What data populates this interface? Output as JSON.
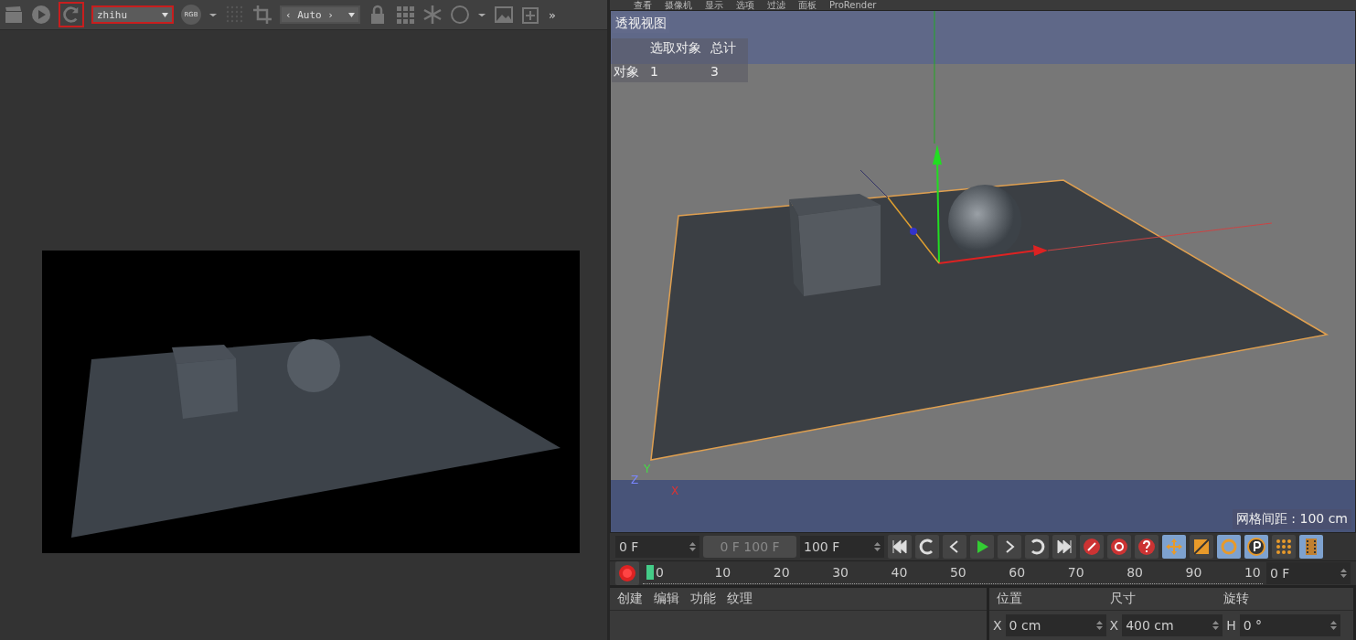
{
  "render_toolbar": {
    "preset": "zhihu",
    "channel_badge": "RGB",
    "zoom_mode": "‹ Auto ›",
    "overflow": "»"
  },
  "viewport_menu": [
    "查看",
    "摄像机",
    "显示",
    "选项",
    "过滤",
    "面板",
    "ProRender"
  ],
  "viewport": {
    "title": "透视视图",
    "stats": {
      "header": [
        "选取对象",
        "总计"
      ],
      "row_label": "对象",
      "selected": "1",
      "total": "3"
    },
    "grid_spacing": "网格间距 : 100 cm",
    "axis_labels": [
      "Z",
      "Y",
      "X"
    ]
  },
  "timeline": {
    "start": "0 F",
    "range": "0 F 100 F",
    "end": "100 F",
    "current": "0 F",
    "ticks": [
      "0",
      "10",
      "20",
      "30",
      "40",
      "50",
      "60",
      "70",
      "80",
      "90",
      "10"
    ],
    "tools": [
      {
        "kind": "move",
        "selected": true
      },
      {
        "kind": "scale",
        "selected": false
      },
      {
        "kind": "rotate",
        "selected": true
      },
      {
        "kind": "param",
        "selected": true
      },
      {
        "kind": "pla",
        "selected": false
      }
    ]
  },
  "material_menu": [
    "创建",
    "编辑",
    "功能",
    "纹理"
  ],
  "coordinates": {
    "headers": [
      "位置",
      "尺寸",
      "旋转"
    ],
    "fields": [
      {
        "axis": "X",
        "value": "0 cm"
      },
      {
        "axis": "X",
        "value": "400 cm"
      },
      {
        "axis": "H",
        "value": "0 °"
      }
    ]
  }
}
